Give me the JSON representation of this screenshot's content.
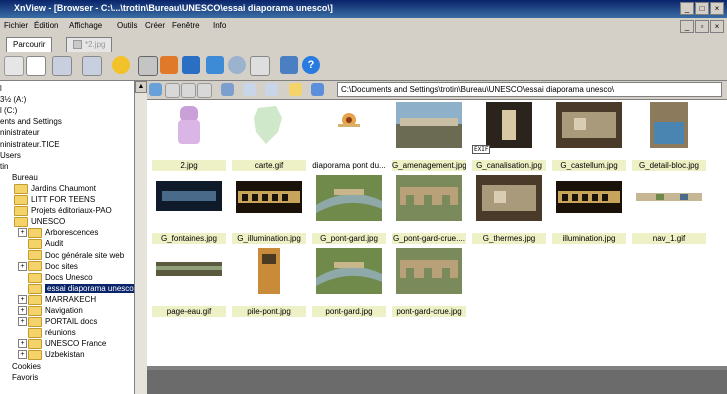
{
  "window": {
    "title": "XnView - [Browser - C:\\...\\trotin\\Bureau\\UNESCO\\essai diaporama unesco\\]"
  },
  "menu": [
    "Fichier",
    "Édition",
    "Affichage",
    "Outils",
    "Créer",
    "Fenêtre",
    "Info"
  ],
  "tabs": [
    {
      "label": "Parcourir",
      "active": true
    },
    {
      "label": "*2.jpg",
      "active": false
    }
  ],
  "path": "C:\\Documents and Settings\\trotin\\Bureau\\UNESCO\\essai diaporama unesco\\",
  "tree": [
    {
      "label": "l",
      "indent": 0,
      "folder": false
    },
    {
      "label": "3½ (A:)",
      "indent": 0,
      "folder": false
    },
    {
      "label": "l (C:)",
      "indent": 0,
      "folder": false
    },
    {
      "label": "ents and Settings",
      "indent": 0,
      "folder": false
    },
    {
      "label": "ninistrateur",
      "indent": 0,
      "folder": false
    },
    {
      "label": "ninistrateur.TICE",
      "indent": 0,
      "folder": false
    },
    {
      "label": "Users",
      "indent": 0,
      "folder": false
    },
    {
      "label": "tin",
      "indent": 0,
      "folder": false
    },
    {
      "label": "Bureau",
      "indent": 1,
      "folder": false
    },
    {
      "label": "Jardins Chaumont",
      "indent": 2,
      "folder": true
    },
    {
      "label": "LITT FOR TEENS",
      "indent": 2,
      "folder": true
    },
    {
      "label": "Projets éditoriaux-PAO",
      "indent": 2,
      "folder": true
    },
    {
      "label": "UNESCO",
      "indent": 2,
      "folder": true
    },
    {
      "label": "Arborescences",
      "indent": 3,
      "folder": true,
      "expander": "+"
    },
    {
      "label": "Audit",
      "indent": 4,
      "folder": true
    },
    {
      "label": "Doc générale site web",
      "indent": 4,
      "folder": true
    },
    {
      "label": "Doc sites",
      "indent": 3,
      "folder": true,
      "expander": "+"
    },
    {
      "label": "Docs Unesco",
      "indent": 4,
      "folder": true
    },
    {
      "label": "essai diaporama unesco",
      "indent": 4,
      "folder": true,
      "selected": true
    },
    {
      "label": "MARRAKECH",
      "indent": 3,
      "folder": true,
      "expander": "+"
    },
    {
      "label": "Navigation",
      "indent": 3,
      "folder": true,
      "expander": "+"
    },
    {
      "label": "PORTAIL docs",
      "indent": 3,
      "folder": true,
      "expander": "+"
    },
    {
      "label": "réunions",
      "indent": 4,
      "folder": true
    },
    {
      "label": "UNESCO France",
      "indent": 3,
      "folder": true,
      "expander": "+"
    },
    {
      "label": "Uzbekistan",
      "indent": 3,
      "folder": true,
      "expander": "+"
    },
    {
      "label": "Cookies",
      "indent": 1,
      "folder": false
    },
    {
      "label": "Favoris",
      "indent": 1,
      "folder": false
    }
  ],
  "files": [
    {
      "name": "2.jpg",
      "highlighted": true,
      "art": "figure"
    },
    {
      "name": "carte.gif",
      "highlighted": true,
      "art": "map"
    },
    {
      "name": "diaporama pont du...",
      "highlighted": false,
      "art": "logo"
    },
    {
      "name": "G_amenagement.jpg",
      "highlighted": true,
      "art": "photo"
    },
    {
      "name": "G_canalisation.jpg",
      "highlighted": true,
      "art": "tunnel",
      "badge": "EXIF"
    },
    {
      "name": "G_castellum.jpg",
      "highlighted": true,
      "art": "ruins"
    },
    {
      "name": "G_detail-bloc.jpg",
      "highlighted": true,
      "art": "water"
    },
    {
      "name": "G_fontaines.jpg",
      "highlighted": true,
      "art": "night"
    },
    {
      "name": "G_illumination.jpg",
      "highlighted": true,
      "art": "bridge-night"
    },
    {
      "name": "G_pont-gard.jpg",
      "highlighted": true,
      "art": "aerial"
    },
    {
      "name": "G_pont-gard-crue....",
      "highlighted": true,
      "art": "bridge"
    },
    {
      "name": "G_thermes.jpg",
      "highlighted": true,
      "art": "ruins"
    },
    {
      "name": "illumination.jpg",
      "highlighted": true,
      "art": "bridge-night"
    },
    {
      "name": "nav_1.gif",
      "highlighted": true,
      "art": "strip"
    },
    {
      "name": "page-eau.gif",
      "highlighted": true,
      "art": "banner"
    },
    {
      "name": "pile-pont.jpg",
      "highlighted": true,
      "art": "pillar"
    },
    {
      "name": "pont-gard.jpg",
      "highlighted": true,
      "art": "aerial"
    },
    {
      "name": "pont-gard-crue.jpg",
      "highlighted": true,
      "art": "bridge"
    }
  ],
  "colors": {
    "titlebar": "#0a246a",
    "selection": "#0a246a",
    "caption_highlight": "#eef0c5",
    "chrome": "#d4d0c8"
  },
  "icons": {
    "toolbar": [
      "drive-icon",
      "page-icon",
      "back-icon",
      "forward-icon",
      "sun-icon",
      "print-icon",
      "scan-icon",
      "camera-icon",
      "image-icon",
      "globe-icon",
      "copy-icon",
      "panel-icon",
      "help-icon"
    ],
    "pathbar": [
      "home-icon",
      "filmstrip-icon",
      "edit-icon",
      "delete-icon",
      "view-icon",
      "sort-icon",
      "filter-icon",
      "up-folder-icon",
      "favorites-icon"
    ]
  }
}
